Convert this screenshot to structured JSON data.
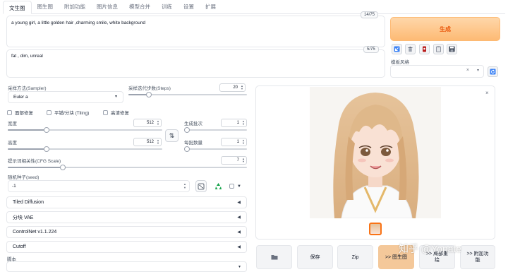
{
  "tabs": [
    {
      "label": "文生图",
      "active": true
    },
    {
      "label": "图生图"
    },
    {
      "label": "附加功能"
    },
    {
      "label": "图片信息"
    },
    {
      "label": "模型合并"
    },
    {
      "label": "训练"
    },
    {
      "label": "设置"
    },
    {
      "label": "扩展"
    }
  ],
  "prompt": {
    "text": "a young girl, a little golden hair ,charming smile, white background",
    "counter": "14/75"
  },
  "negative_prompt": {
    "text": "fat , dim, unreal",
    "counter": "5/75"
  },
  "generate_label": "生成",
  "style": {
    "label": "模板风格",
    "clear": "×",
    "arrow": "▾"
  },
  "sampler": {
    "label": "采样方法(Sampler)",
    "value": "Euler a",
    "arrow": "▾"
  },
  "steps": {
    "label": "采样迭代步数(Steps)",
    "value": "20",
    "fraction": 0.17
  },
  "checks": {
    "face_restore": "面部修复",
    "tiling": "平铺/分块 (Tiling)",
    "hires": "高清修复"
  },
  "width": {
    "label": "宽度",
    "value": "512",
    "fraction": 0.25
  },
  "height": {
    "label": "高度",
    "value": "512",
    "fraction": 0.25
  },
  "swap_icon": "⇅",
  "batch_count": {
    "label": "生成批次",
    "value": "1",
    "fraction": 0.0
  },
  "batch_size": {
    "label": "每批数量",
    "value": "1",
    "fraction": 0.0
  },
  "cfg": {
    "label": "提示词相关性(CFG Scale)",
    "value": "7",
    "fraction": 0.23
  },
  "seed": {
    "label": "随机种子(seed)",
    "value": "-1",
    "extra_arrow": "▼"
  },
  "accordions": [
    {
      "label": "Tiled Diffusion",
      "arrow": "◀"
    },
    {
      "label": "分块 VAE",
      "arrow": "◀"
    },
    {
      "label": "ControlNet v1.1.224",
      "arrow": "◀"
    },
    {
      "label": "Cutoff",
      "arrow": "◀"
    }
  ],
  "script_label": "脚本",
  "output": {
    "close": "×"
  },
  "bottom_buttons": {
    "save": "保存",
    "zip": "Zip",
    "to_img2img": ">> 图生图",
    "to_inpaint_a": ">> 局部重",
    "to_inpaint_b": "绘",
    "to_extras_a": ">> 附加功",
    "to_extras_b": "能"
  },
  "watermark": "知乎 @Yonate",
  "colors": {
    "accent": "#ea580c",
    "generate_bg": "#fdba74"
  }
}
